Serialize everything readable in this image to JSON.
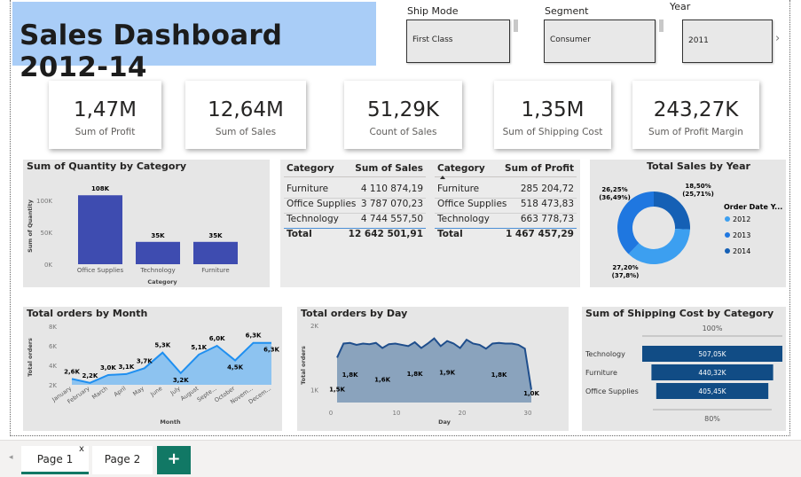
{
  "header": {
    "title": "Sales Dashboard 2012-14"
  },
  "slicers": [
    {
      "label": "Ship Mode",
      "value": "First Class"
    },
    {
      "label": "Segment",
      "value": "Consumer"
    },
    {
      "label": "Year",
      "value": "2011"
    }
  ],
  "kpis": [
    {
      "value": "1,47M",
      "label": "Sum of Profit"
    },
    {
      "value": "12,64M",
      "label": "Sum of Sales"
    },
    {
      "value": "51,29K",
      "label": "Count of Sales"
    },
    {
      "value": "1,35M",
      "label": "Sum of Shipping Cost"
    },
    {
      "value": "243,27K",
      "label": "Sum of Profit Margin"
    }
  ],
  "sales_table": {
    "headers": [
      "Category",
      "Sum of Sales"
    ],
    "rows": [
      [
        "Furniture",
        "4 110 874,19"
      ],
      [
        "Office Supplies",
        "3 787 070,23"
      ],
      [
        "Technology",
        "4 744 557,50"
      ]
    ],
    "total": [
      "Total",
      "12 642 501,91"
    ]
  },
  "profit_table": {
    "headers": [
      "Category",
      "Sum of Profit"
    ],
    "rows": [
      [
        "Furniture",
        "285 204,72"
      ],
      [
        "Office Supplies",
        "518 473,83"
      ],
      [
        "Technology",
        "663 778,73"
      ]
    ],
    "total": [
      "Total",
      "1 467 457,29"
    ]
  },
  "tabs": {
    "page1": "Page 1",
    "page2": "Page 2",
    "close": "x",
    "add": "+"
  },
  "colors": {
    "bar": "#3e4cb0",
    "area": "#7cbcf1",
    "line": "#1f8ff0",
    "day_area": "#8aa3bd",
    "day_line": "#1f4e8c",
    "shipping": "#114c85",
    "donut1": "#3c9ff0",
    "donut2": "#1f77e0",
    "donut3": "#1560b5"
  },
  "chart_data": [
    {
      "type": "bar",
      "title": "Sum of Quantity by Category",
      "xlabel": "Category",
      "ylabel": "Sum of Quantity",
      "categories": [
        "Office Supplies",
        "Technology",
        "Furniture"
      ],
      "values": [
        108000,
        35000,
        35000
      ],
      "data_labels": [
        "108K",
        "35K",
        "35K"
      ],
      "yticks": [
        "0K",
        "50K",
        "100K"
      ],
      "ylim": [
        0,
        125000
      ]
    },
    {
      "type": "pie",
      "title": "Total Sales by Year",
      "legend_title": "Order Date Y...",
      "categories": [
        "2012",
        "2013",
        "2014"
      ],
      "values": [
        26.25,
        27.2,
        18.5
      ],
      "percent_of_total": [
        36.49,
        37.8,
        25.71
      ],
      "data_labels": [
        [
          "26,25%",
          "(36,49%)"
        ],
        [
          "27,20%",
          "(37,8%)"
        ],
        [
          "18,50%",
          "(25,71%)"
        ]
      ],
      "legend": "right"
    },
    {
      "type": "area",
      "title": "Total orders by Month",
      "xlabel": "Month",
      "ylabel": "Total orders",
      "categories": [
        "January",
        "February",
        "March",
        "April",
        "May",
        "June",
        "July",
        "August",
        "Septe...",
        "October",
        "Novem...",
        "Decem..."
      ],
      "values": [
        2600,
        2200,
        3000,
        3100,
        3700,
        5300,
        3200,
        5100,
        6000,
        4500,
        6300,
        6300
      ],
      "data_labels": [
        "2,6K",
        "2,2K",
        "3,0K",
        "3,1K",
        "3,7K",
        "5,3K",
        "3,2K",
        "5,1K",
        "6,0K",
        "4,5K",
        "6,3K",
        "6,3K"
      ],
      "yticks": [
        "2K",
        "4K",
        "6K",
        "8K"
      ],
      "ylim": [
        2000,
        8000
      ]
    },
    {
      "type": "area",
      "title": "Total orders by Day",
      "xlabel": "Day",
      "ylabel": "Total orders",
      "x": [
        1,
        2,
        3,
        4,
        5,
        6,
        7,
        8,
        9,
        10,
        11,
        12,
        13,
        14,
        15,
        16,
        17,
        18,
        19,
        20,
        21,
        22,
        23,
        24,
        25,
        26,
        27,
        28,
        29,
        30,
        31
      ],
      "values": [
        1500,
        1720,
        1730,
        1700,
        1720,
        1710,
        1730,
        1650,
        1710,
        1720,
        1700,
        1680,
        1740,
        1650,
        1720,
        1800,
        1680,
        1760,
        1720,
        1650,
        1780,
        1720,
        1700,
        1640,
        1720,
        1730,
        1720,
        1720,
        1700,
        1640,
        1000
      ],
      "data_labels": [
        {
          "x": 1,
          "label": "1,5K"
        },
        {
          "x": 3,
          "label": "1,8K"
        },
        {
          "x": 8,
          "label": "1,6K"
        },
        {
          "x": 13,
          "label": "1,8K"
        },
        {
          "x": 18,
          "label": "1,9K"
        },
        {
          "x": 26,
          "label": "1,8K"
        },
        {
          "x": 31,
          "label": "1,0K"
        }
      ],
      "xticks": [
        "0",
        "10",
        "20",
        "30"
      ],
      "yticks": [
        "1K",
        "2K"
      ],
      "ylim": [
        800,
        2100
      ]
    },
    {
      "type": "bar",
      "orientation": "horizontal",
      "title": "Sum of Shipping Cost by Category",
      "categories": [
        "Technology",
        "Furniture",
        "Office Supplies"
      ],
      "values": [
        507050,
        440320,
        405450
      ],
      "data_labels": [
        "507,05K",
        "440,32K",
        "405,45K"
      ],
      "top_label": "100%",
      "bottom_label": "80%"
    }
  ]
}
